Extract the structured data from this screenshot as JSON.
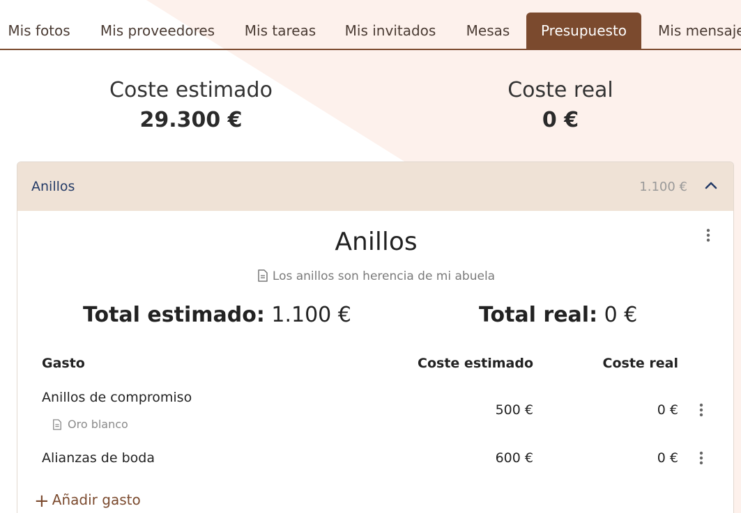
{
  "tabs": [
    {
      "label": "Mis fotos"
    },
    {
      "label": "Mis proveedores"
    },
    {
      "label": "Mis tareas"
    },
    {
      "label": "Mis invitados"
    },
    {
      "label": "Mesas"
    },
    {
      "label": "Presupuesto",
      "active": true
    },
    {
      "label": "Mis mensajes"
    }
  ],
  "summary": {
    "estimated_label": "Coste estimado",
    "estimated_value": "29.300 €",
    "real_label": "Coste real",
    "real_value": "0 €"
  },
  "category": {
    "name": "Anillos",
    "amount": "1.100 €",
    "title": "Anillos",
    "note": "Los anillos son herencia de mi abuela",
    "total_estimated_label": "Total estimado:",
    "total_estimated_value": "1.100 €",
    "total_real_label": "Total real:",
    "total_real_value": "0 €",
    "columns": {
      "expense": "Gasto",
      "estimated": "Coste estimado",
      "real": "Coste real"
    },
    "rows": [
      {
        "name": "Anillos de compromiso",
        "note": "Oro blanco",
        "estimated": "500 €",
        "real": "0 €"
      },
      {
        "name": "Alianzas de boda",
        "estimated": "600 €",
        "real": "0 €"
      }
    ],
    "add_label": "Añadir gasto"
  },
  "icons": {
    "collapse": "chevron-up-icon",
    "more": "more-vertical-icon",
    "note": "document-icon",
    "add": "plus-icon"
  },
  "colors": {
    "accent": "#7b4a2e",
    "header_bg": "#efe2d6",
    "decor_bg": "#fdf1ec",
    "link_blue": "#233a66"
  }
}
